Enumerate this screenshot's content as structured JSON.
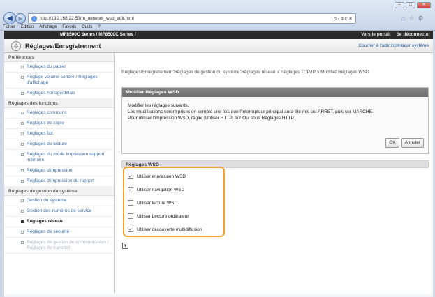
{
  "browser": {
    "url": "http://192.168.22.53/m_network_wsd_edit.html",
    "addr_tools": "ρ - ᴃ c ✕",
    "menu": [
      "Fichier",
      "Édition",
      "Affichage",
      "Favoris",
      "Outils",
      "?"
    ]
  },
  "header": {
    "model": "MF8500C Series / MF8500C Series /",
    "portal_link": "Vers le portail",
    "logout_link": "Se déconnecter",
    "title": "Réglages/Enregistrement",
    "admin_link": "Courrier à l'administrateur système"
  },
  "sidebar": {
    "sections": [
      {
        "label": "Préférences"
      },
      {
        "label": "Réglages des fonctions"
      },
      {
        "label": "Réglages de gestion du système"
      }
    ],
    "items": [
      {
        "label": "Réglages du papier"
      },
      {
        "label": "Réglage volume sonore / Réglages d'affichage"
      },
      {
        "label": "Réglages horloge/délais"
      },
      {
        "label": "Réglages communs"
      },
      {
        "label": "Réglages de copie"
      },
      {
        "label": "Réglages fax"
      },
      {
        "label": "Réglages de lecture"
      },
      {
        "label": "Réglages du mode Impression support mémoire"
      },
      {
        "label": "Réglages d'impression"
      },
      {
        "label": "Réglages d'impression du rapport"
      },
      {
        "label": "Gestion du système"
      },
      {
        "label": "Gestion des numéros de service"
      },
      {
        "label": "Réglages réseau"
      },
      {
        "label": "Réglages de sécurité"
      },
      {
        "label": "Réglages de gestion de communication / Réglages de transfert"
      }
    ]
  },
  "main": {
    "breadcrumb": "Réglages/Enregistrement:Réglages de gestion du système:Réglages réseau > Réglages TCP/IP > Modifier Réglages WSD",
    "panel": {
      "title": "Modifier Réglages WSD",
      "line1": "Modifier les réglages suivants.",
      "line2": "Les modifications seront prises en compte une fois que l'interrupteur principal aura été mis sur ARRET, puis sur MARCHE.",
      "line3": "Pour utiliser l'impression WSD, régler [Utiliser HTTP] sur Oui sous Réglages HTTP.",
      "ok": "OK",
      "cancel": "Annuler"
    },
    "wsd": {
      "title": "Réglages WSD",
      "options": [
        {
          "label": "Utiliser impression WSD",
          "checked": true
        },
        {
          "label": "Utiliser navigation WSD",
          "checked": true
        },
        {
          "label": "Utiliser lecture WSD",
          "checked": false
        },
        {
          "label": "Utiliser Lecture ordinateur",
          "checked": false
        },
        {
          "label": "Utiliser découverte multidiffusion",
          "checked": true
        }
      ]
    }
  },
  "colors": {
    "highlight": "#f0a134",
    "link": "#3b6aa6",
    "topbar": "#2a2a2a"
  }
}
